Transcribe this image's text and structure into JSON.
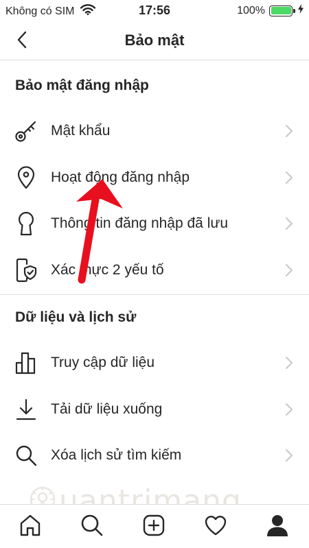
{
  "status_bar": {
    "carrier": "Không có SIM",
    "time": "17:56",
    "battery": "100%",
    "battery_level": 1.0,
    "wifi_icon": "wifi-icon",
    "charging_icon": "charging-bolt-icon"
  },
  "navbar": {
    "title": "Bảo mật",
    "back_icon": "chevron-left-icon"
  },
  "sections": [
    {
      "header": "Bảo mật đăng nhập",
      "items": [
        {
          "label": "Mật khẩu",
          "icon": "key-icon"
        },
        {
          "label": "Hoạt động đăng nhập",
          "icon": "location-pin-icon"
        },
        {
          "label": "Thông tin đăng nhập đã lưu",
          "icon": "keyhole-icon"
        },
        {
          "label": "Xác thực 2 yếu tố",
          "icon": "phone-shield-icon"
        }
      ]
    },
    {
      "header": "Dữ liệu và lịch sử",
      "items": [
        {
          "label": "Truy cập dữ liệu",
          "icon": "bar-chart-icon"
        },
        {
          "label": "Tải dữ liệu xuống",
          "icon": "download-icon"
        },
        {
          "label": "Xóa lịch sử tìm kiếm",
          "icon": "search-icon"
        }
      ]
    }
  ],
  "watermark": {
    "text": "uantrimang"
  },
  "tabbar": {
    "items": [
      {
        "icon": "home-icon"
      },
      {
        "icon": "search-icon"
      },
      {
        "icon": "add-post-icon"
      },
      {
        "icon": "heart-icon"
      },
      {
        "icon": "profile-icon"
      }
    ]
  },
  "colors": {
    "text": "#262626",
    "divider": "#dbdbdb",
    "chevron": "#c7c7cc",
    "battery": "#4cd964",
    "annotation_arrow": "#e8101e"
  }
}
